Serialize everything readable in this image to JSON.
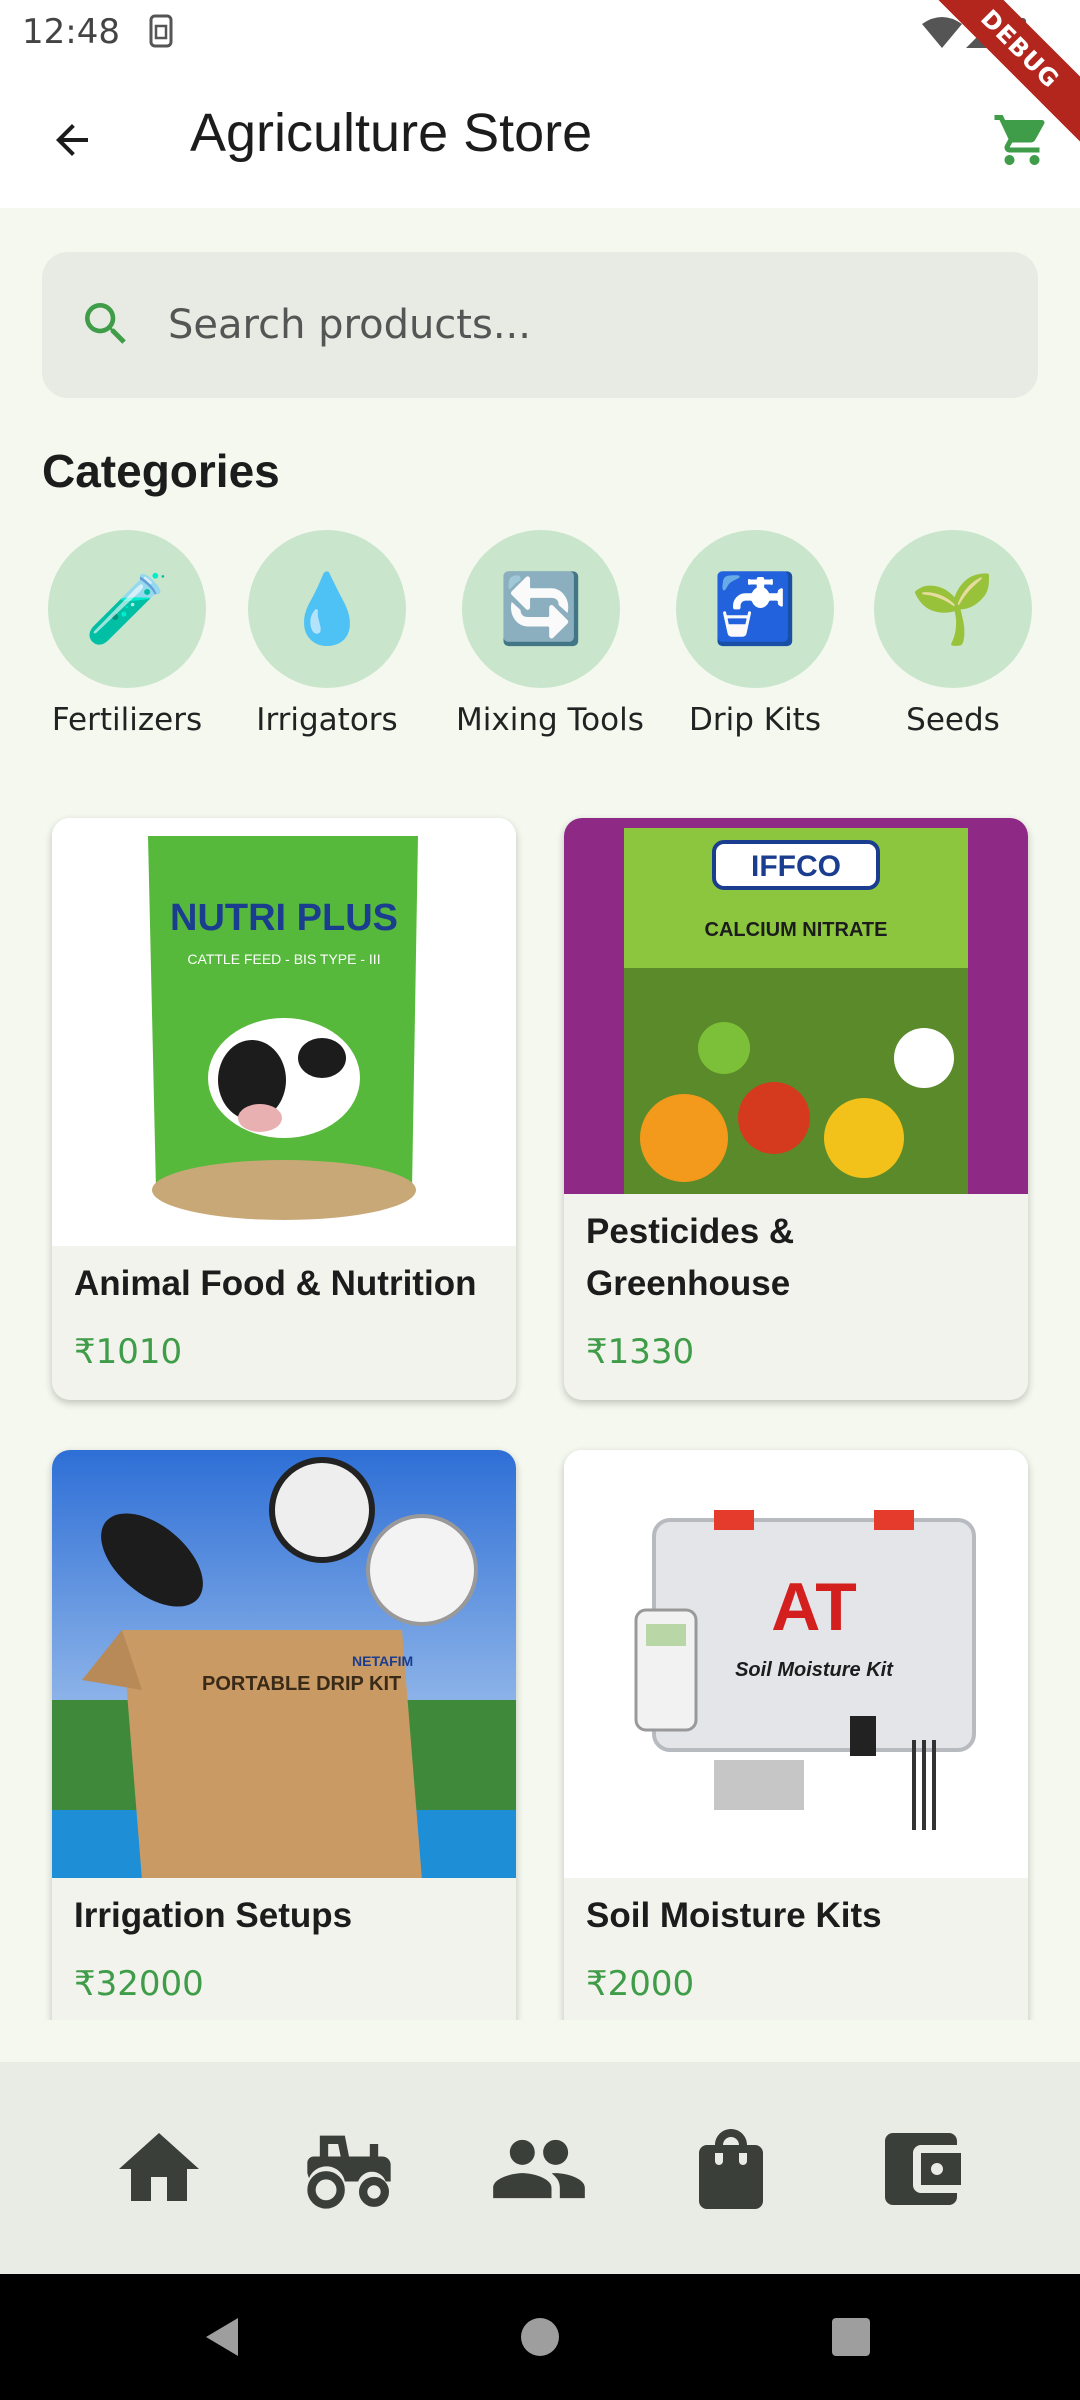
{
  "status_bar": {
    "time": "12:48"
  },
  "debug_banner": "DEBUG",
  "app_bar": {
    "title": "Agriculture Store"
  },
  "search": {
    "placeholder": "Search products..."
  },
  "categories_section": {
    "title": "Categories",
    "items": [
      {
        "label": "Fertilizers",
        "icon": "test-tube-icon",
        "glyph": "🧪"
      },
      {
        "label": "Irrigators",
        "icon": "droplet-icon",
        "glyph": "💧"
      },
      {
        "label": "Mixing Tools",
        "icon": "repeat-arrows-icon",
        "glyph": "🔄"
      },
      {
        "label": "Drip Kits",
        "icon": "water-tap-icon",
        "glyph": "🚰"
      },
      {
        "label": "Seeds",
        "icon": "seedling-icon",
        "glyph": "🌱"
      }
    ]
  },
  "products": [
    {
      "name": "Animal Food & Nutrition",
      "price": "₹1010",
      "image_text_1": "NUTRI PLUS",
      "image_text_2": "CATTLE FEED - BIS TYPE - III"
    },
    {
      "name": "Pesticides & Greenhouse",
      "price": "₹1330",
      "image_text_1": "IFFCO",
      "image_text_2": "CALCIUM NITRATE"
    },
    {
      "name": "Irrigation Setups",
      "price": "₹32000",
      "image_text_1": "PORTABLE DRIP KIT",
      "image_text_2": "NETAFIM"
    },
    {
      "name": "Soil Moisture Kits",
      "price": "₹2000",
      "image_text_1": "AT",
      "image_text_2": "Soil Moisture Kit"
    }
  ],
  "bottom_nav": [
    {
      "icon": "home-icon"
    },
    {
      "icon": "tractor-icon"
    },
    {
      "icon": "people-icon"
    },
    {
      "icon": "shopping-bag-icon"
    },
    {
      "icon": "wallet-icon"
    }
  ],
  "colors": {
    "accent": "#3f9c48",
    "background": "#f4f8ee",
    "category_circle": "#c9e5cc",
    "search_bg": "#e8ebe3",
    "nav_bg": "#e9ece4",
    "icon_dark": "#3a3f3a"
  }
}
